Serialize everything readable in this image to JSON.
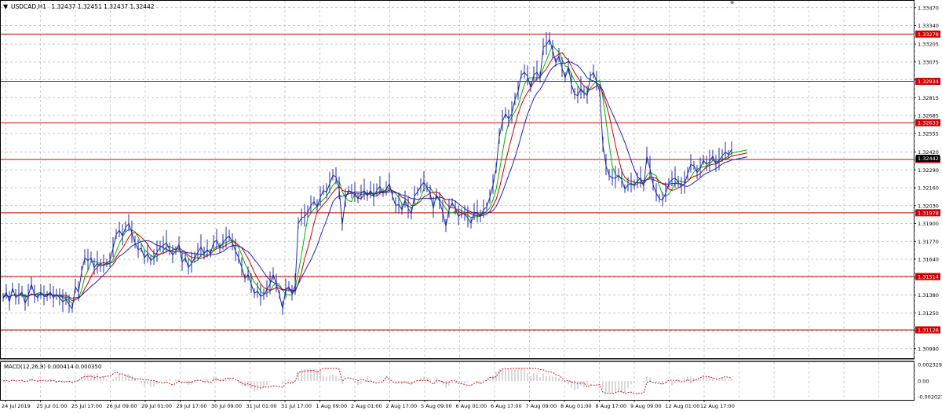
{
  "chart_data": {
    "type": "line",
    "symbol": "USDCAD,H1",
    "ohlc_header": "1.32437 1.32451 1.32437 1.32442",
    "last_price": "1.32442",
    "y_ticks": [
      "1.33470",
      "1.33340",
      "1.33205",
      "1.33075",
      "1.32945",
      "1.32815",
      "1.32685",
      "1.32555",
      "1.32420",
      "1.32290",
      "1.32160",
      "1.32030",
      "1.31900",
      "1.31770",
      "1.31640",
      "1.31510",
      "1.31380",
      "1.31250",
      "1.31120",
      "1.30990"
    ],
    "x_ticks": [
      "24 Jul 2019",
      "25 Jul 01:00",
      "25 Jul 17:00",
      "26 Jul 09:00",
      "29 Jul 01:00",
      "29 Jul 17:00",
      "30 Jul 09:00",
      "31 Jul 01:00",
      "31 Jul 17:00",
      "1 Aug 09:00",
      "2 Aug 01:00",
      "2 Aug 17:00",
      "5 Aug 09:00",
      "6 Aug 01:00",
      "6 Aug 17:00",
      "7 Aug 09:00",
      "8 Aug 01:00",
      "8 Aug 17:00",
      "9 Aug 09:00",
      "12 Aug 01:00",
      "12 Aug 17:00"
    ],
    "ylim": [
      1.3092,
      1.3352
    ],
    "levels": [
      "1.33278",
      "1.32934",
      "1.32633",
      "1.32366",
      "1.31978",
      "1.31514",
      "1.31126"
    ],
    "level_color": "#d00000",
    "price_color": "#1f2fa0",
    "ma_colors": {
      "fast": "#00b000",
      "mid": "#d00000",
      "slow": "#2020b0"
    },
    "price_path": [
      [
        0,
        1.3136
      ],
      [
        4,
        1.314
      ],
      [
        8,
        1.3133
      ],
      [
        12,
        1.3143
      ],
      [
        16,
        1.3136
      ],
      [
        20,
        1.3138
      ],
      [
        24,
        1.314
      ],
      [
        28,
        1.3132
      ],
      [
        32,
        1.3137
      ],
      [
        36,
        1.3146
      ],
      [
        40,
        1.3138
      ],
      [
        44,
        1.3136
      ],
      [
        48,
        1.314
      ],
      [
        52,
        1.3137
      ],
      [
        56,
        1.3137
      ],
      [
        60,
        1.314
      ],
      [
        64,
        1.3136
      ],
      [
        68,
        1.3138
      ],
      [
        72,
        1.3136
      ],
      [
        76,
        1.3133
      ],
      [
        80,
        1.3135
      ],
      [
        84,
        1.3131
      ],
      [
        88,
        1.3128
      ],
      [
        92,
        1.3144
      ],
      [
        96,
        1.314
      ],
      [
        100,
        1.3155
      ],
      [
        104,
        1.3165
      ],
      [
        108,
        1.3163
      ],
      [
        112,
        1.3165
      ],
      [
        116,
        1.3158
      ],
      [
        120,
        1.3161
      ],
      [
        124,
        1.3159
      ],
      [
        128,
        1.316
      ],
      [
        132,
        1.3161
      ],
      [
        136,
        1.3163
      ],
      [
        140,
        1.3172
      ],
      [
        144,
        1.3182
      ],
      [
        148,
        1.3185
      ],
      [
        152,
        1.3181
      ],
      [
        156,
        1.3187
      ],
      [
        160,
        1.319
      ],
      [
        164,
        1.3183
      ],
      [
        168,
        1.3176
      ],
      [
        172,
        1.3171
      ],
      [
        176,
        1.3172
      ],
      [
        180,
        1.3165
      ],
      [
        184,
        1.3168
      ],
      [
        188,
        1.3163
      ],
      [
        192,
        1.3165
      ],
      [
        196,
        1.3169
      ],
      [
        200,
        1.3173
      ],
      [
        204,
        1.3174
      ],
      [
        208,
        1.3176
      ],
      [
        212,
        1.3171
      ],
      [
        216,
        1.3167
      ],
      [
        220,
        1.317
      ],
      [
        224,
        1.3175
      ],
      [
        228,
        1.3162
      ],
      [
        232,
        1.3165
      ],
      [
        236,
        1.3158
      ],
      [
        240,
        1.3161
      ],
      [
        244,
        1.3165
      ],
      [
        248,
        1.3169
      ],
      [
        252,
        1.3173
      ],
      [
        256,
        1.3168
      ],
      [
        260,
        1.3171
      ],
      [
        264,
        1.3168
      ],
      [
        268,
        1.3176
      ],
      [
        272,
        1.3178
      ],
      [
        276,
        1.3172
      ],
      [
        280,
        1.3176
      ],
      [
        284,
        1.3179
      ],
      [
        288,
        1.3181
      ],
      [
        292,
        1.3176
      ],
      [
        296,
        1.317
      ],
      [
        300,
        1.3165
      ],
      [
        304,
        1.3158
      ],
      [
        308,
        1.315
      ],
      [
        312,
        1.3153
      ],
      [
        316,
        1.3146
      ],
      [
        320,
        1.3139
      ],
      [
        324,
        1.3141
      ],
      [
        328,
        1.3137
      ],
      [
        332,
        1.3138
      ],
      [
        336,
        1.3142
      ],
      [
        340,
        1.3146
      ],
      [
        344,
        1.3153
      ],
      [
        348,
        1.3146
      ],
      [
        352,
        1.3138
      ],
      [
        356,
        1.3128
      ],
      [
        360,
        1.3142
      ],
      [
        364,
        1.3144
      ],
      [
        368,
        1.3139
      ],
      [
        372,
        1.3145
      ],
      [
        376,
        1.319
      ],
      [
        380,
        1.3194
      ],
      [
        384,
        1.3195
      ],
      [
        388,
        1.3198
      ],
      [
        392,
        1.3203
      ],
      [
        396,
        1.3206
      ],
      [
        400,
        1.3202
      ],
      [
        404,
        1.3209
      ],
      [
        408,
        1.3214
      ],
      [
        412,
        1.3213
      ],
      [
        416,
        1.3219
      ],
      [
        420,
        1.3225
      ],
      [
        424,
        1.3224
      ],
      [
        428,
        1.3215
      ],
      [
        432,
        1.3189
      ],
      [
        436,
        1.3208
      ],
      [
        440,
        1.3214
      ],
      [
        444,
        1.3213
      ],
      [
        448,
        1.3212
      ],
      [
        452,
        1.3208
      ],
      [
        456,
        1.3212
      ],
      [
        460,
        1.3214
      ],
      [
        464,
        1.321
      ],
      [
        468,
        1.3214
      ],
      [
        472,
        1.321
      ],
      [
        476,
        1.3214
      ],
      [
        480,
        1.3217
      ],
      [
        484,
        1.3212
      ],
      [
        488,
        1.3215
      ],
      [
        492,
        1.3219
      ],
      [
        496,
        1.321
      ],
      [
        500,
        1.3203
      ],
      [
        504,
        1.3204
      ],
      [
        508,
        1.32
      ],
      [
        512,
        1.3207
      ],
      [
        516,
        1.3201
      ],
      [
        520,
        1.3197
      ],
      [
        524,
        1.321
      ],
      [
        528,
        1.3213
      ],
      [
        532,
        1.3217
      ],
      [
        536,
        1.322
      ],
      [
        540,
        1.3216
      ],
      [
        544,
        1.3212
      ],
      [
        548,
        1.3201
      ],
      [
        552,
        1.3211
      ],
      [
        556,
        1.3206
      ],
      [
        560,
        1.3198
      ],
      [
        564,
        1.3188
      ],
      [
        568,
        1.32
      ],
      [
        572,
        1.3205
      ],
      [
        576,
        1.3201
      ],
      [
        580,
        1.3195
      ],
      [
        584,
        1.3197
      ],
      [
        588,
        1.3197
      ],
      [
        592,
        1.3194
      ],
      [
        596,
        1.319
      ],
      [
        600,
        1.3198
      ],
      [
        604,
        1.3198
      ],
      [
        608,
        1.3195
      ],
      [
        612,
        1.32
      ],
      [
        616,
        1.3202
      ],
      [
        620,
        1.3209
      ],
      [
        624,
        1.3218
      ],
      [
        628,
        1.323
      ],
      [
        632,
        1.3253
      ],
      [
        636,
        1.3264
      ],
      [
        640,
        1.327
      ],
      [
        644,
        1.3266
      ],
      [
        648,
        1.327
      ],
      [
        652,
        1.328
      ],
      [
        656,
        1.3286
      ],
      [
        660,
        1.3298
      ],
      [
        664,
        1.33
      ],
      [
        668,
        1.3297
      ],
      [
        672,
        1.3289
      ],
      [
        676,
        1.3298
      ],
      [
        680,
        1.33
      ],
      [
        684,
        1.3296
      ],
      [
        688,
        1.3318
      ],
      [
        692,
        1.332
      ],
      [
        696,
        1.3324
      ],
      [
        700,
        1.3316
      ],
      [
        704,
        1.3307
      ],
      [
        708,
        1.3312
      ],
      [
        712,
        1.3303
      ],
      [
        716,
        1.3296
      ],
      [
        720,
        1.3304
      ],
      [
        724,
        1.3291
      ],
      [
        728,
        1.3284
      ],
      [
        732,
        1.3283
      ],
      [
        736,
        1.3288
      ],
      [
        740,
        1.3285
      ],
      [
        744,
        1.3283
      ],
      [
        748,
        1.3297
      ],
      [
        752,
        1.33
      ],
      [
        756,
        1.3293
      ],
      [
        760,
        1.3286
      ],
      [
        764,
        1.3247
      ],
      [
        768,
        1.3232
      ],
      [
        772,
        1.3225
      ],
      [
        776,
        1.3223
      ],
      [
        780,
        1.3223
      ],
      [
        784,
        1.3225
      ],
      [
        788,
        1.3222
      ],
      [
        792,
        1.3215
      ],
      [
        796,
        1.3218
      ],
      [
        800,
        1.3219
      ],
      [
        804,
        1.3218
      ],
      [
        808,
        1.3221
      ],
      [
        812,
        1.3223
      ],
      [
        816,
        1.3217
      ],
      [
        820,
        1.3239
      ],
      [
        824,
        1.323
      ],
      [
        828,
        1.3218
      ],
      [
        832,
        1.3212
      ],
      [
        836,
        1.3208
      ],
      [
        840,
        1.3207
      ],
      [
        844,
        1.3212
      ],
      [
        848,
        1.3219
      ],
      [
        852,
        1.3222
      ],
      [
        856,
        1.3223
      ],
      [
        860,
        1.322
      ],
      [
        864,
        1.3217
      ],
      [
        868,
        1.3219
      ],
      [
        872,
        1.3226
      ],
      [
        876,
        1.3233
      ],
      [
        880,
        1.3232
      ],
      [
        884,
        1.3227
      ],
      [
        888,
        1.323
      ],
      [
        892,
        1.3236
      ],
      [
        896,
        1.3233
      ],
      [
        900,
        1.3235
      ],
      [
        904,
        1.3239
      ],
      [
        908,
        1.3233
      ],
      [
        912,
        1.3236
      ],
      [
        916,
        1.3239
      ],
      [
        920,
        1.3242
      ],
      [
        924,
        1.324
      ],
      [
        928,
        1.3244
      ]
    ]
  },
  "indicator": {
    "label": "MACD(12,26,9) 0.000414 0.000350",
    "y_ticks": [
      "0.002329",
      "0.00",
      "-0.002027"
    ]
  }
}
